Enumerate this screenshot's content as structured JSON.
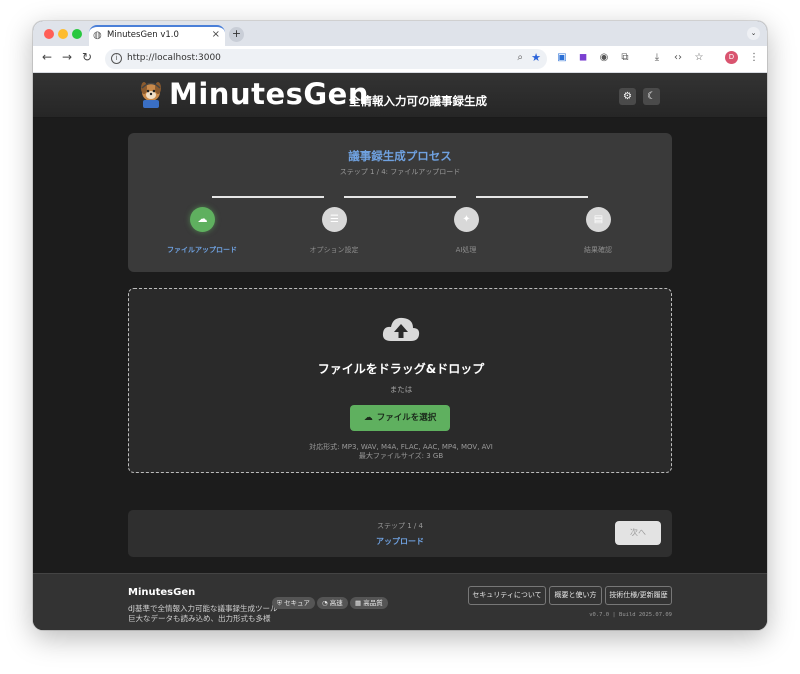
{
  "browser": {
    "tab_title": "MinutesGen v1.0",
    "url": "http://localhost:3000",
    "new_tab_icon": "plus-icon",
    "profile_initial": "D"
  },
  "header": {
    "title": "MinutesGen",
    "subtitle": "全情報入力可の議事録生成",
    "settings_icon": "gear-icon",
    "theme_icon": "moon-icon"
  },
  "process": {
    "title": "議事録生成プロセス",
    "step_text": "ステップ 1 / 4: ファイルアップロード",
    "steps": [
      {
        "label": "ファイルアップロード",
        "icon": "cloud-upload-icon",
        "active": true
      },
      {
        "label": "オプション設定",
        "icon": "sliders-icon",
        "active": false
      },
      {
        "label": "AI処理",
        "icon": "sparkle-icon",
        "active": false
      },
      {
        "label": "結果確認",
        "icon": "document-icon",
        "active": false
      }
    ]
  },
  "dropzone": {
    "title": "ファイルをドラッグ&ドロップ",
    "or": "または",
    "button": "ファイルを選択",
    "formats": "対応形式: MP3, WAV, M4A, FLAC, AAC, MP4, MOV, AVI",
    "max_size": "最大ファイルサイズ: 3 GB"
  },
  "step_nav": {
    "step": "ステップ 1 / 4",
    "label": "アップロード",
    "next": "次へ"
  },
  "footer": {
    "brand": "MinutesGen",
    "desc1": "dJ基準で全情報入力可能な議事録生成ツール",
    "desc2": "巨大なデータも読み込め、出力形式も多様",
    "badges": [
      "セキュア",
      "高速",
      "高品質"
    ],
    "links": [
      "セキュリティについて",
      "概要と使い方",
      "技術仕様/更新履歴"
    ],
    "version": "v0.7.0 | Build 2025.07.09"
  },
  "colors": {
    "accent_blue": "#6fa1e0",
    "active_green": "#5fb05f",
    "page_bg": "#1c1c1c",
    "card_bg": "#3a3a3a"
  }
}
